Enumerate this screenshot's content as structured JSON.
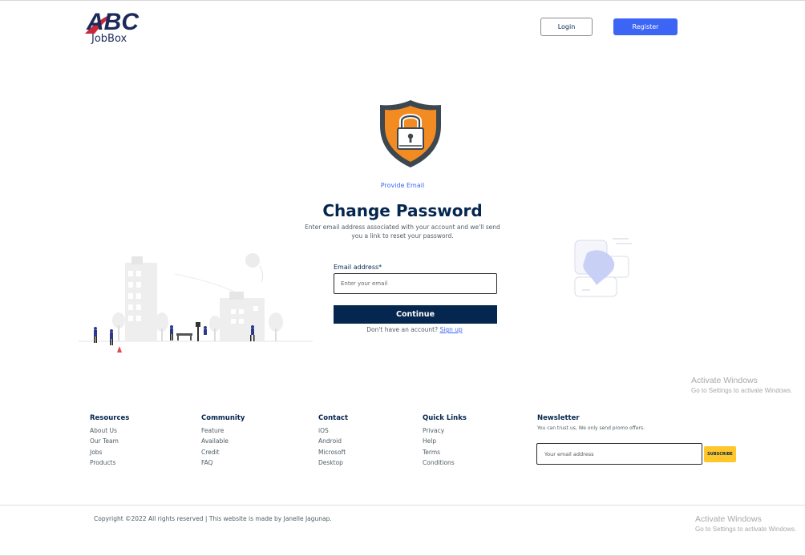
{
  "header": {
    "logo_mark": "ABC",
    "logo_text": "JobBox",
    "login_label": "Login",
    "register_label": "Register"
  },
  "form": {
    "tag": "Provide Email",
    "title": "Change Password",
    "subtitle": "Enter email address associated with your account and we'll send you a link to reset your password.",
    "email_label": "Email address*",
    "email_placeholder": "Enter your email",
    "email_value": "",
    "continue_label": "Continue",
    "signup_prompt": "Don't have an account?",
    "signup_link": "Sign up"
  },
  "icons": {
    "shield": "shield-lock-icon"
  },
  "footer": {
    "columns": [
      {
        "heading": "Resources",
        "links": [
          "About Us",
          "Our Team",
          "Jobs",
          "Products"
        ]
      },
      {
        "heading": "Community",
        "links": [
          "Feature",
          "Available",
          "Credit",
          "FAQ"
        ]
      },
      {
        "heading": "Contact",
        "links": [
          "iOS",
          "Android",
          "Microsoft",
          "Desktop"
        ]
      },
      {
        "heading": "Quick Links",
        "links": [
          "Privacy",
          "Help",
          "Terms",
          "Conditions"
        ]
      }
    ],
    "newsletter": {
      "heading": "Newsletter",
      "text": "You can trust us, We only send promo offers.",
      "placeholder": "Your email address",
      "button": "SUBSCRIBE"
    },
    "copyright": "Copyright ©2022 All rights reserved | This website is made by Janelle Jagunap."
  },
  "watermark": {
    "line1": "Activate Windows",
    "line2": "Go to Settings to activate Windows."
  },
  "colors": {
    "primary": "#05264e",
    "accent": "#3c65f5",
    "shield_orange": "#f28c22",
    "subscribe_yellow": "#ffc72c"
  }
}
